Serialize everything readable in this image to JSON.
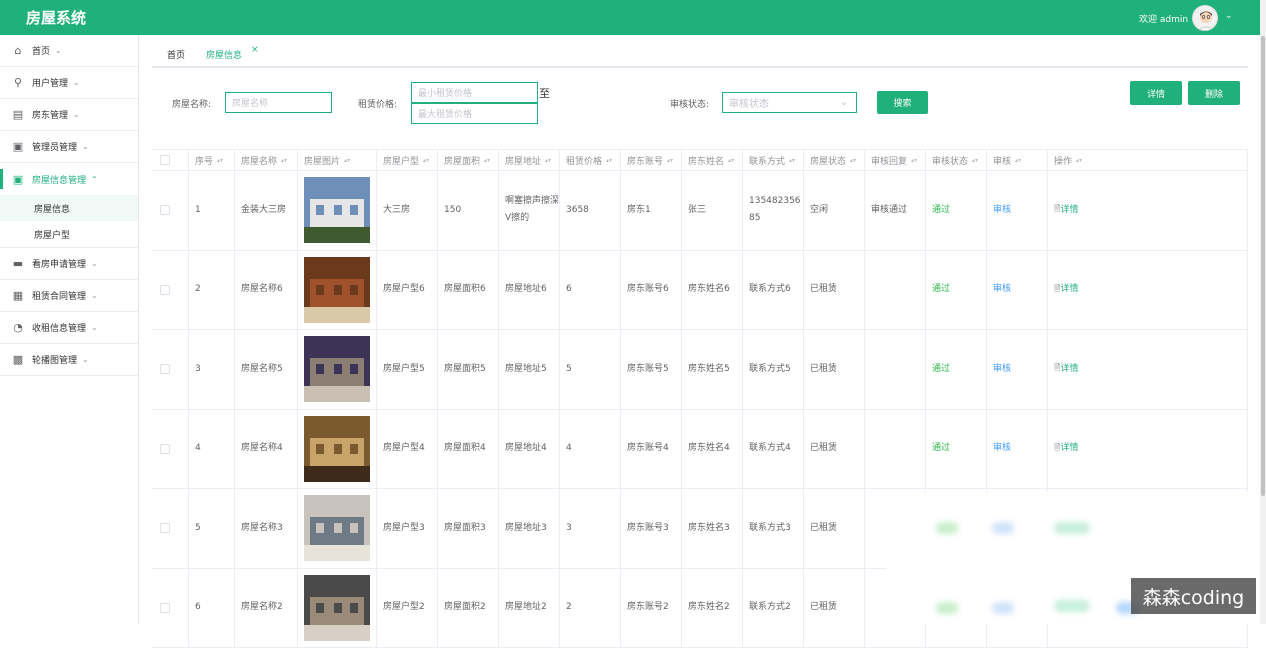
{
  "header": {
    "title": "房屋系统",
    "welcome": "欢迎 admin"
  },
  "sidebar": {
    "items": [
      {
        "label": "首页",
        "icon": "home-icon"
      },
      {
        "label": "用户管理",
        "icon": "user-icon"
      },
      {
        "label": "房东管理",
        "icon": "list-icon"
      },
      {
        "label": "管理员管理",
        "icon": "briefcase-icon"
      },
      {
        "label": "房屋信息管理",
        "icon": "house-icon",
        "active": true,
        "children": [
          {
            "label": "房屋信息",
            "active": true
          },
          {
            "label": "房屋户型"
          }
        ]
      },
      {
        "label": "看房申请管理",
        "icon": "monitor-icon"
      },
      {
        "label": "租赁合同管理",
        "icon": "grid-icon"
      },
      {
        "label": "收租信息管理",
        "icon": "pie-icon"
      },
      {
        "label": "轮播图管理",
        "icon": "tiles-icon"
      }
    ]
  },
  "tabs": [
    {
      "label": "首页"
    },
    {
      "label": "房屋信息",
      "active": true
    }
  ],
  "search": {
    "name_label": "房屋名称:",
    "name_placeholder": "房屋名称",
    "price_label": "租赁价格:",
    "min_price_placeholder": "最小租赁价格",
    "max_price_placeholder": "最大租赁价格",
    "to": "至",
    "status_label": "审核状态:",
    "status_placeholder": "审核状态",
    "search_button": "搜索",
    "detail_button": "详情",
    "delete_button": "删除"
  },
  "table": {
    "columns": [
      "序号",
      "房屋名称",
      "房屋图片",
      "房屋户型",
      "房屋面积",
      "房屋地址",
      "租赁价格",
      "房东账号",
      "房东姓名",
      "联系方式",
      "房屋状态",
      "审核回复",
      "审核状态",
      "审核",
      "操作"
    ],
    "rows": [
      {
        "no": "1",
        "name": "金装大三房",
        "type": "大三房",
        "area": "150",
        "address": "啊塞擦声擦深V擦的",
        "price": "3658",
        "account": "房东1",
        "owner": "张三",
        "phone": "13548235685",
        "state": "空闲",
        "reply": "审核通过",
        "status": "通过",
        "audit": "审核",
        "action": "详情"
      },
      {
        "no": "2",
        "name": "房屋名称6",
        "type": "房屋户型6",
        "area": "房屋面积6",
        "address": "房屋地址6",
        "price": "6",
        "account": "房东账号6",
        "owner": "房东姓名6",
        "phone": "联系方式6",
        "state": "已租赁",
        "reply": "",
        "status": "通过",
        "audit": "审核",
        "action": "详情"
      },
      {
        "no": "3",
        "name": "房屋名称5",
        "type": "房屋户型5",
        "area": "房屋面积5",
        "address": "房屋地址5",
        "price": "5",
        "account": "房东账号5",
        "owner": "房东姓名5",
        "phone": "联系方式5",
        "state": "已租赁",
        "reply": "",
        "status": "通过",
        "audit": "审核",
        "action": "详情"
      },
      {
        "no": "4",
        "name": "房屋名称4",
        "type": "房屋户型4",
        "area": "房屋面积4",
        "address": "房屋地址4",
        "price": "4",
        "account": "房东账号4",
        "owner": "房东姓名4",
        "phone": "联系方式4",
        "state": "已租赁",
        "reply": "",
        "status": "通过",
        "audit": "审核",
        "action": "详情"
      },
      {
        "no": "5",
        "name": "房屋名称3",
        "type": "房屋户型3",
        "area": "房屋面积3",
        "address": "房屋地址3",
        "price": "3",
        "account": "房东账号3",
        "owner": "房东姓名3",
        "phone": "联系方式3",
        "state": "已租赁",
        "reply": "",
        "status": "",
        "audit": "",
        "action": ""
      },
      {
        "no": "6",
        "name": "房屋名称2",
        "type": "房屋户型2",
        "area": "房屋面积2",
        "address": "房屋地址2",
        "price": "2",
        "account": "房东账号2",
        "owner": "房东姓名2",
        "phone": "联系方式2",
        "state": "已租赁",
        "reply": "",
        "status": "",
        "audit": "",
        "action": ""
      }
    ]
  },
  "watermark": "森森coding"
}
